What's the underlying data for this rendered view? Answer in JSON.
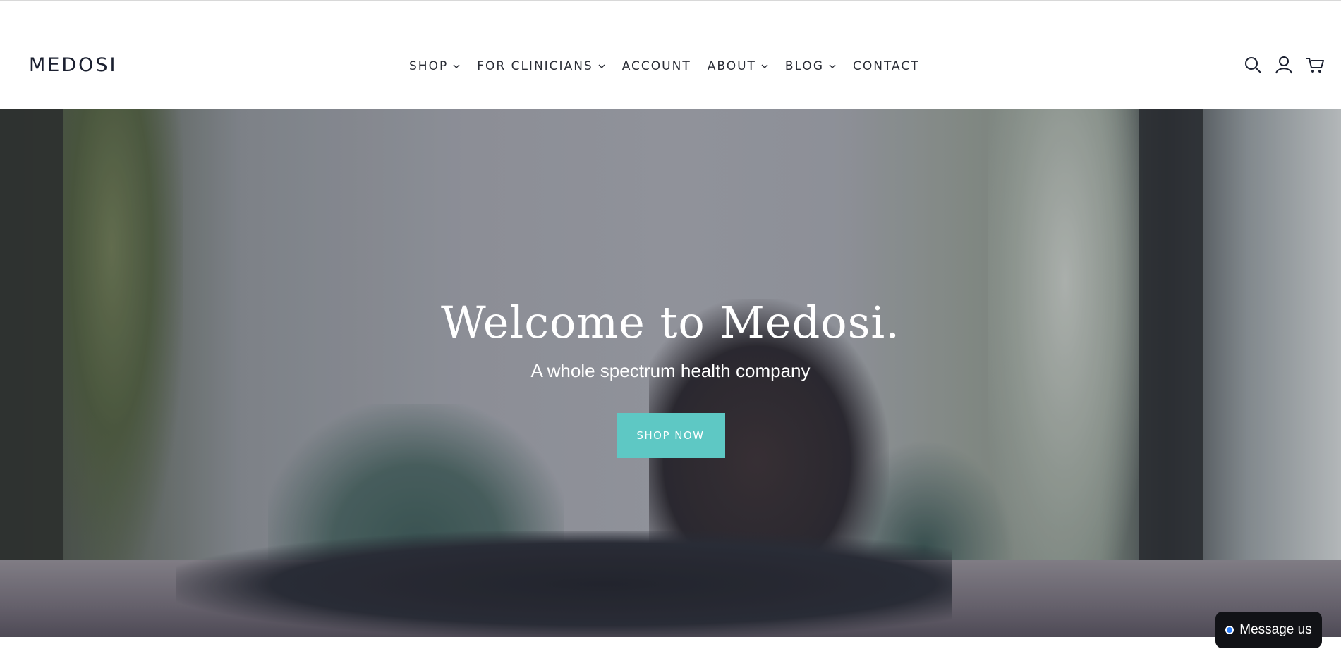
{
  "header": {
    "logo": "MEDOSI",
    "nav": [
      {
        "label": "SHOP",
        "has_dropdown": true
      },
      {
        "label": "FOR CLINICIANS",
        "has_dropdown": true
      },
      {
        "label": "ACCOUNT",
        "has_dropdown": false
      },
      {
        "label": "ABOUT",
        "has_dropdown": true
      },
      {
        "label": "BLOG",
        "has_dropdown": true
      },
      {
        "label": "CONTACT",
        "has_dropdown": false
      }
    ],
    "icons": [
      "search-icon",
      "account-icon",
      "cart-icon"
    ]
  },
  "hero": {
    "title": "Welcome to Medosi.",
    "subtitle": "A whole spectrum health company",
    "cta_label": "SHOP NOW",
    "cta_color": "#5ec8c4"
  },
  "chat": {
    "label": "Message us",
    "dot_color": "#2d7ff9"
  }
}
